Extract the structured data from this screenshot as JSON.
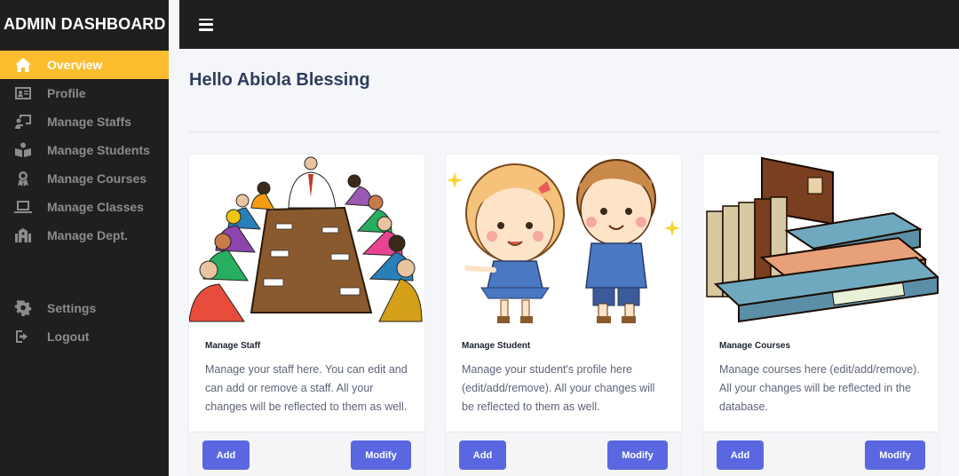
{
  "brand": {
    "title": "ADMIN DASHBOARD"
  },
  "sidebar": {
    "items": [
      {
        "label": "Overview",
        "icon": "home-icon",
        "active": true
      },
      {
        "label": "Profile",
        "icon": "id-card-icon"
      },
      {
        "label": "Manage Staffs",
        "icon": "chalkboard-teacher-icon"
      },
      {
        "label": "Manage Students",
        "icon": "reading-student-icon"
      },
      {
        "label": "Manage Courses",
        "icon": "award-icon"
      },
      {
        "label": "Manage Classes",
        "icon": "laptop-icon"
      },
      {
        "label": "Manage Dept.",
        "icon": "school-building-icon"
      }
    ],
    "bottom_items": [
      {
        "label": "Settings",
        "icon": "gear-icon"
      },
      {
        "label": "Logout",
        "icon": "sign-out-icon"
      }
    ]
  },
  "main": {
    "greeting": "Hello Abiola Blessing",
    "cards": [
      {
        "title": "Manage Staff",
        "description": "Manage your staff here. You can edit and can add or remove a staff. All your changes will be reflected to them as well.",
        "image": "staff-meeting-illustration",
        "add_label": "Add",
        "modify_label": "Modify"
      },
      {
        "title": "Manage Student",
        "description": "Manage your student's profile here (edit/add/remove). All your changes will be reflected to them as well.",
        "image": "students-illustration",
        "add_label": "Add",
        "modify_label": "Modify"
      },
      {
        "title": "Manage Courses",
        "description": "Manage courses here (edit/add/remove). All your changes will be reflected in the database.",
        "image": "books-illustration",
        "add_label": "Add",
        "modify_label": "Modify"
      }
    ]
  },
  "colors": {
    "sidebar_bg": "#1f1f1f",
    "active_accent": "#fbbd2e",
    "button": "#5a67e0",
    "greeting_text": "#2f3d5c"
  }
}
